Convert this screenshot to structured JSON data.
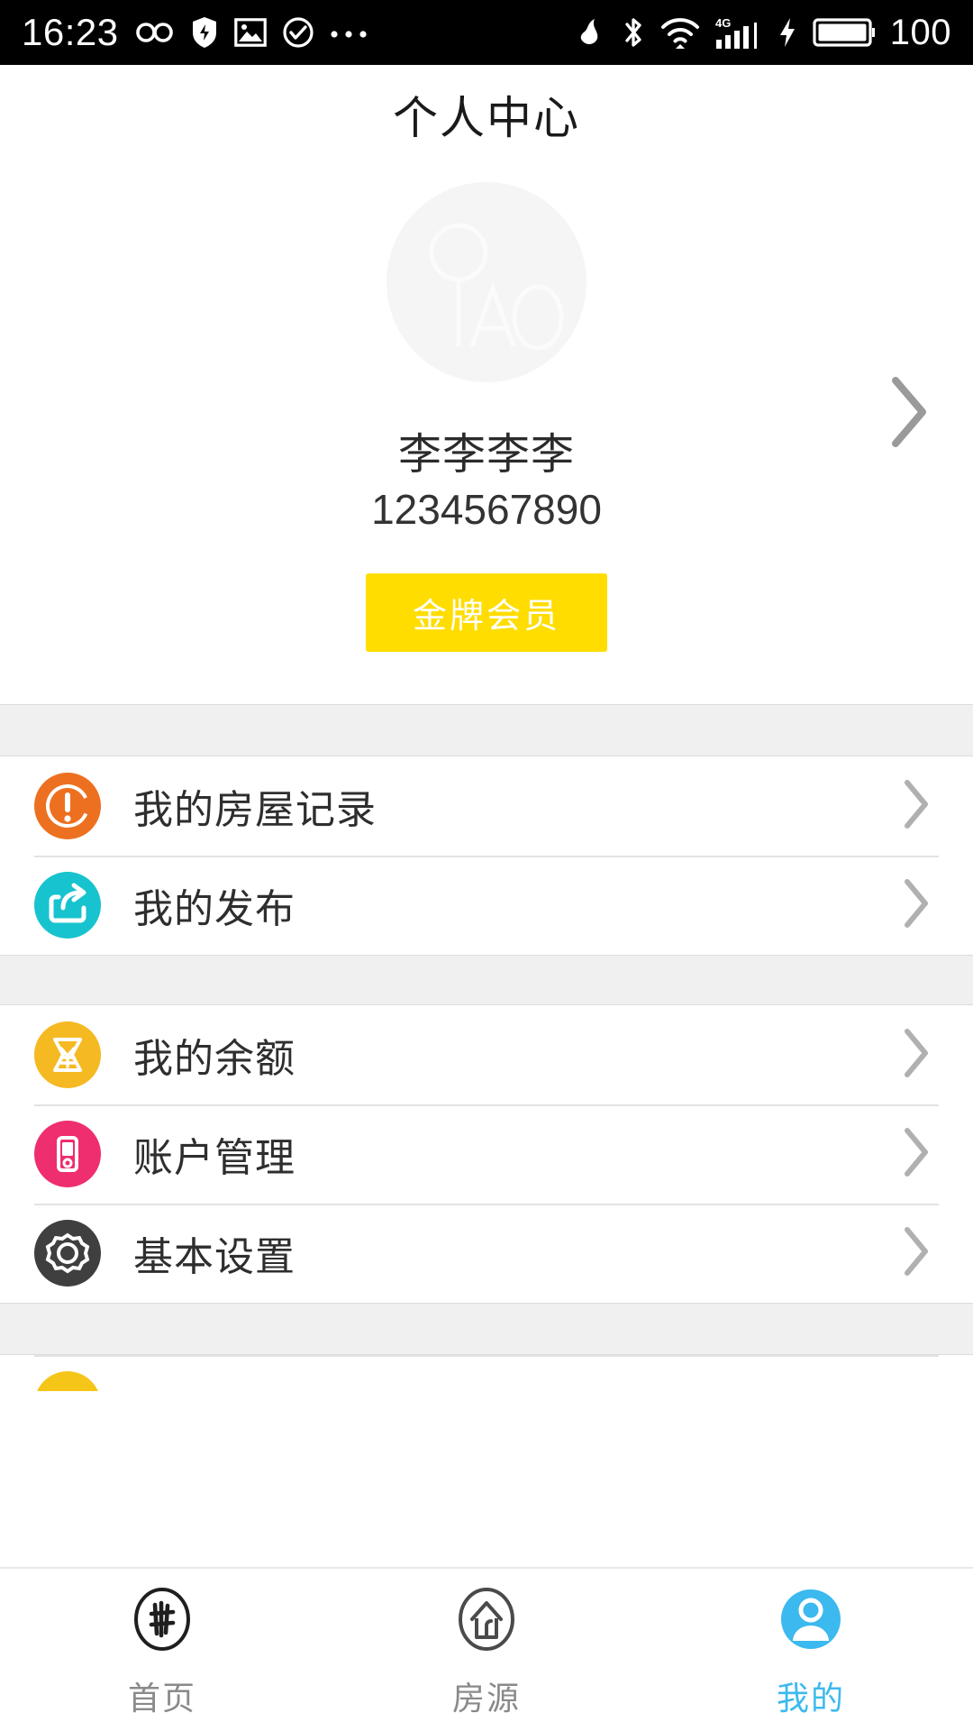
{
  "statusbar": {
    "time": "16:23",
    "battery_percent": "100",
    "left_icons": [
      "infinity-icon",
      "shield-bolt-icon",
      "image-icon",
      "check-circle-icon",
      "more-dots-icon"
    ],
    "right_icons": [
      "mute-icon",
      "bluetooth-icon",
      "wifi-icon",
      "signal-4g-icon",
      "charging-bolt-icon",
      "battery-icon"
    ]
  },
  "header": {
    "title": "个人中心"
  },
  "profile": {
    "avatar_text": "QIAO",
    "name": "李李李李",
    "phone": "1234567890",
    "badge_label": "金牌会员",
    "badge_color": "#FFDD00",
    "chevron": "chevron-right-icon"
  },
  "menu_groups": [
    {
      "items": [
        {
          "label": "我的房屋记录",
          "icon": "alert-circle-icon",
          "color": "#ED7020"
        },
        {
          "label": "我的发布",
          "icon": "share-export-icon",
          "color": "#17C3CE"
        }
      ]
    },
    {
      "items": [
        {
          "label": "我的余额",
          "icon": "wallet-yen-icon",
          "color": "#F5B921"
        },
        {
          "label": "账户管理",
          "icon": "mobile-phone-icon",
          "color": "#EE2E6E"
        },
        {
          "label": "基本设置",
          "icon": "gear-icon",
          "color": "#3F3F3F"
        }
      ]
    }
  ],
  "cutoff_item": {
    "icon": "partial-yellow-icon",
    "color": "#F5C518"
  },
  "tabbar": {
    "active_color": "#3CB9EE",
    "inactive_color": "#8A8A8A",
    "tabs": [
      {
        "label": "首页",
        "icon": "home-logo-icon",
        "active": false
      },
      {
        "label": "房源",
        "icon": "house-circle-icon",
        "active": false
      },
      {
        "label": "我的",
        "icon": "user-circle-icon",
        "active": true
      }
    ]
  }
}
